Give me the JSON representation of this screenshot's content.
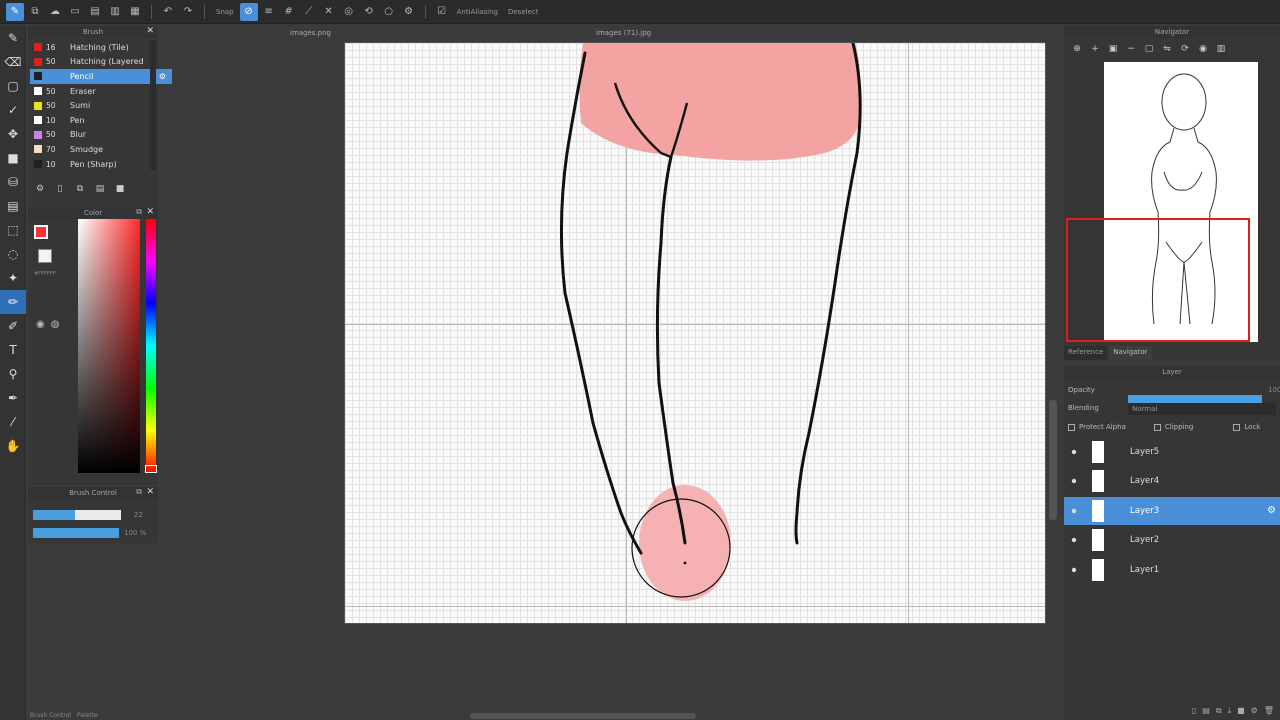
{
  "toolbar": {
    "snap_label": "Snap",
    "antialias_label": "AntiAliasing",
    "deselect_label": "Deselect"
  },
  "tabs": {
    "left_doc": "images.png",
    "center_doc": "images (71).jpg"
  },
  "brush_panel": {
    "title": "Brush",
    "items": [
      {
        "size": "16",
        "name": "Hatching (Tile)",
        "color": "#e02020"
      },
      {
        "size": "50",
        "name": "Hatching (Layered",
        "color": "#e02020"
      },
      {
        "size": "",
        "name": "Pencil",
        "color": "#202020"
      },
      {
        "size": "50",
        "name": "Eraser",
        "color": "#ffffff"
      },
      {
        "size": "50",
        "name": "Sumi",
        "color": "#e8e020"
      },
      {
        "size": "10",
        "name": "Pen",
        "color": "#ffffff"
      },
      {
        "size": "50",
        "name": "Blur",
        "color": "#d080e0"
      },
      {
        "size": "70",
        "name": "Smudge",
        "color": "#f0e0c0"
      },
      {
        "size": "10",
        "name": "Pen (Sharp)",
        "color": "#202020"
      }
    ]
  },
  "color_panel": {
    "title": "Color",
    "fg_color": "#ff3030",
    "bg_color": "#f2f2f2",
    "hex_text": "#FFFFFF"
  },
  "brush_control": {
    "title": "Brush Control",
    "size_value": "22",
    "size_fraction": 0.48,
    "opacity_value": "100 %",
    "opacity_fraction": 1.0
  },
  "navigator": {
    "title": "Navigator",
    "tab_reference": "Reference",
    "tab_navigator": "Navigator"
  },
  "layer_panel": {
    "title": "Layer",
    "opacity_label": "Opacity",
    "opacity_value": "100",
    "blending_label": "Blending",
    "blending_value": "Normal",
    "protect_alpha_label": "Protect Alpha",
    "clipping_label": "Clipping",
    "lock_label": "Lock",
    "layers": [
      {
        "name": "Layer5",
        "selected": false
      },
      {
        "name": "Layer4",
        "selected": false
      },
      {
        "name": "Layer3",
        "selected": true
      },
      {
        "name": "Layer2",
        "selected": false
      },
      {
        "name": "Layer1",
        "selected": false
      }
    ]
  },
  "bottom_tabs": {
    "brush_control": "Brush Control",
    "palette": "Palette"
  },
  "colors": {
    "accent": "#4a90d9",
    "skin_fill": "#f4a3a3",
    "nav_frame": "#e02020"
  }
}
